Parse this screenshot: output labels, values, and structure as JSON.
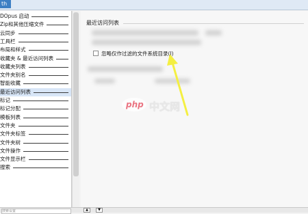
{
  "window": {
    "title_fragment": "th"
  },
  "sidebar": {
    "items": [
      {
        "label": "DOpus 启动",
        "selected": false
      },
      {
        "label": "Zip和其他压缩文件",
        "selected": false
      },
      {
        "label": "云同步",
        "selected": false
      },
      {
        "label": "工具栏",
        "selected": false
      },
      {
        "label": "布局和样式",
        "selected": false
      },
      {
        "label": "收藏夹 & 最近访问列表",
        "selected": false
      },
      {
        "label": "收藏夹列表",
        "selected": false
      },
      {
        "label": "文件夹别名",
        "selected": false
      },
      {
        "label": "智能收藏",
        "selected": false
      },
      {
        "label": "最近访问列表",
        "selected": true
      },
      {
        "label": "标记",
        "selected": false
      },
      {
        "label": "标记分配",
        "selected": false
      },
      {
        "label": "模板列表",
        "selected": false
      },
      {
        "label": "文件夹",
        "selected": false
      },
      {
        "label": "文件夹标签",
        "selected": false
      },
      {
        "label": "文件夹树",
        "selected": false
      },
      {
        "label": "文件操作",
        "selected": false
      },
      {
        "label": "文件显示栏",
        "selected": false
      },
      {
        "label": "搜索",
        "selected": false
      }
    ]
  },
  "main": {
    "section_title": "最近访问列表",
    "checkbox": {
      "label": "忽略仅作过滤的文件系统目录(I)",
      "checked": false
    }
  },
  "bottom": {
    "filter_placeholder": "搜索设置",
    "up_arrow": "▲",
    "down_arrow": "▼"
  },
  "annotation": {
    "arrow_color": "#f4ef42"
  },
  "watermark": {
    "logo": "php",
    "text": "中文网"
  }
}
